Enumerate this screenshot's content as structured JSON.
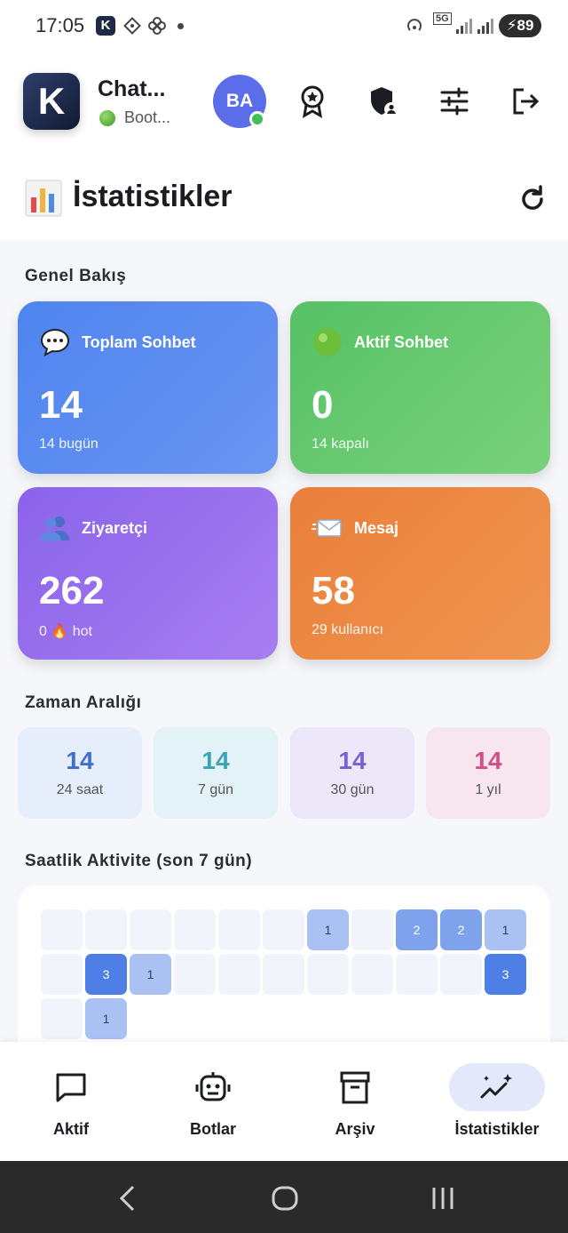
{
  "status_bar": {
    "time": "17:05",
    "k_badge": "K",
    "network": "5G",
    "battery": "89"
  },
  "header": {
    "logo_letter": "K",
    "title": "Chat...",
    "subtitle": "Boot...",
    "avatar_initials": "BA"
  },
  "page": {
    "title": "İstatistikler"
  },
  "overview": {
    "label": "Genel Bakış",
    "cards": [
      {
        "title": "Toplam Sohbet",
        "value": "14",
        "sub": "14 bugün"
      },
      {
        "title": "Aktif Sohbet",
        "value": "0",
        "sub": "14 kapalı"
      },
      {
        "title": "Ziyaretçi",
        "value": "262",
        "sub": "0 🔥 hot"
      },
      {
        "title": "Mesaj",
        "value": "58",
        "sub": "29 kullanıcı"
      }
    ]
  },
  "time_range": {
    "label": "Zaman Aralığı",
    "items": [
      {
        "value": "14",
        "label": "24 saat",
        "color": "#3f6fd6",
        "bg": "#e6eefc"
      },
      {
        "value": "14",
        "label": "7 gün",
        "color": "#3aa3b8",
        "bg": "#e3f2f6"
      },
      {
        "value": "14",
        "label": "30 gün",
        "color": "#7a5fd6",
        "bg": "#ece8fa"
      },
      {
        "value": "14",
        "label": "1 yıl",
        "color": "#d64d86",
        "bg": "#f8e6ee"
      }
    ]
  },
  "activity": {
    "label": "Saatlik Aktivite (son 7 gün)",
    "rows": [
      [
        "",
        "",
        "",
        "",
        "",
        "",
        "1",
        "",
        "2",
        "2",
        "1"
      ],
      [
        "",
        "3",
        "1",
        "",
        "",
        "",
        "",
        "",
        "",
        "",
        "3"
      ],
      [
        "",
        "1"
      ]
    ]
  },
  "bottom_nav": [
    {
      "label": "Aktif"
    },
    {
      "label": "Botlar"
    },
    {
      "label": "Arşiv"
    },
    {
      "label": "İstatistikler"
    }
  ]
}
